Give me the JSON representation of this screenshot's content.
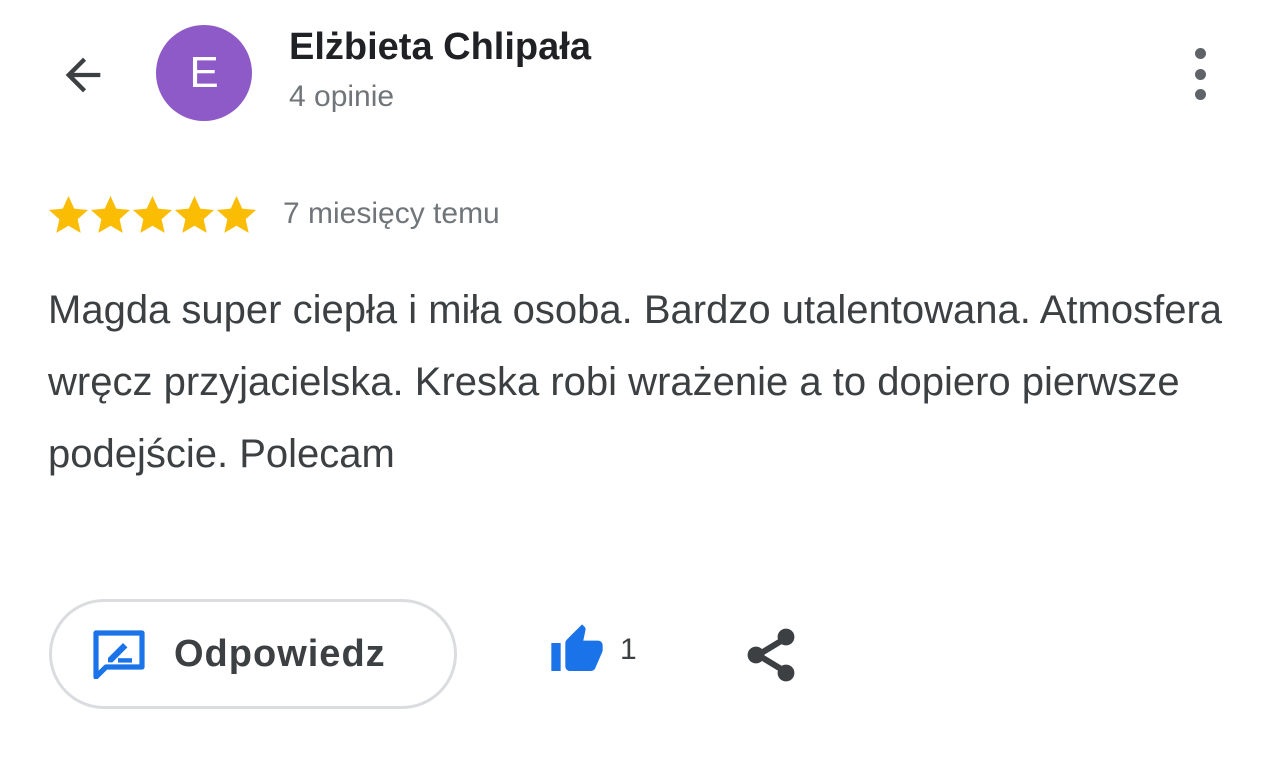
{
  "header": {
    "back_icon": "arrow-back-icon",
    "avatar_letter": "E",
    "avatar_color": "#8e5ac8",
    "reviewer_name": "Elżbieta Chlipała",
    "review_count": "4 opinie",
    "more_icon": "more-vert-icon"
  },
  "review": {
    "rating": 5,
    "rating_max": 5,
    "star_color": "#fbbc04",
    "date": "7 miesięcy temu",
    "text": "Magda super ciepła i miła osoba. Bardzo utalentowana. Atmosfera wręcz przyjacielska. Kreska robi wrażenie a to dopiero pierwsze podejście. Polecam"
  },
  "actions": {
    "reply_label": "Odpowiedz",
    "reply_icon": "rate-review-icon",
    "like_count": "1",
    "like_icon": "thumb-up-icon",
    "share_icon": "share-icon",
    "accent_color": "#1a73e8"
  }
}
